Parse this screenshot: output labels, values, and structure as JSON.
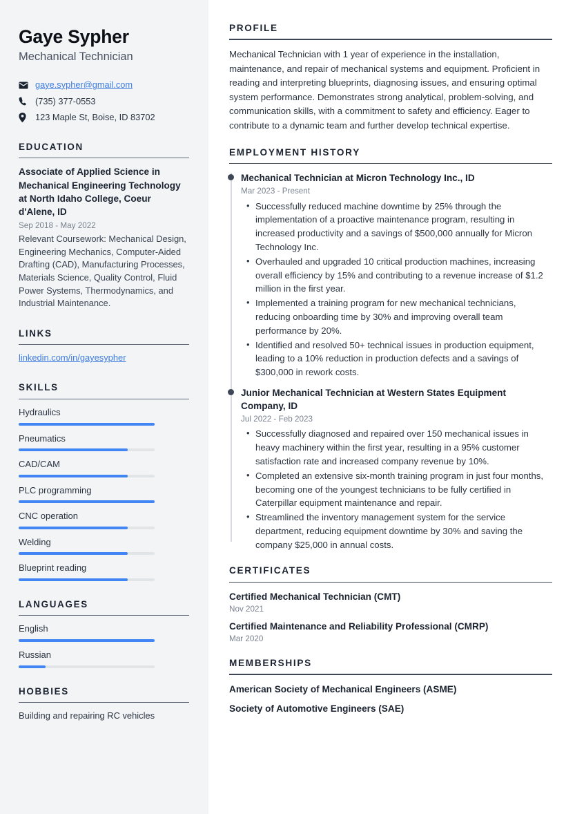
{
  "theme": {
    "accent_blue": "#4285f4",
    "link_blue": "#3f7de0",
    "sidebar_bg": "#f2f4f6",
    "heading_color": "#1b2330",
    "muted_text": "#7a828f",
    "timeline_dot": "#3f4756"
  },
  "sidebar": {
    "name": "Gaye Sypher",
    "job_title": "Mechanical Technician",
    "contacts": [
      {
        "icon": "envelope-icon",
        "text": "gaye.sypher@gmail.com",
        "is_link": true
      },
      {
        "icon": "phone-icon",
        "text": "(735) 377-0553",
        "is_link": false
      },
      {
        "icon": "map-pin-icon",
        "text": "123 Maple St, Boise, ID 83702",
        "is_link": false
      }
    ],
    "education": {
      "heading": "EDUCATION",
      "degree": "Associate of Applied Science in Mechanical Engineering Technology at North Idaho College, Coeur d'Alene, ID",
      "date": "Sep 2018 - May 2022",
      "description": "Relevant Coursework: Mechanical Design, Engineering Mechanics, Computer-Aided Drafting (CAD), Manufacturing Processes, Materials Science, Quality Control, Fluid Power Systems, Thermodynamics, and Industrial Maintenance."
    },
    "links": {
      "heading": "LINKS",
      "items": [
        {
          "label": "linkedin.com/in/gayesypher"
        }
      ]
    },
    "skills": {
      "heading": "SKILLS",
      "items": [
        {
          "label": "Hydraulics",
          "level": 100
        },
        {
          "label": "Pneumatics",
          "level": 80
        },
        {
          "label": "CAD/CAM",
          "level": 80
        },
        {
          "label": "PLC programming",
          "level": 100
        },
        {
          "label": "CNC operation",
          "level": 80
        },
        {
          "label": "Welding",
          "level": 80
        },
        {
          "label": "Blueprint reading",
          "level": 80
        }
      ]
    },
    "languages": {
      "heading": "LANGUAGES",
      "items": [
        {
          "label": "English",
          "level": 100
        },
        {
          "label": "Russian",
          "level": 20
        }
      ]
    },
    "hobbies": {
      "heading": "HOBBIES",
      "items": [
        {
          "label": "Building and repairing RC vehicles"
        }
      ]
    }
  },
  "main": {
    "profile": {
      "heading": "PROFILE",
      "text": "Mechanical Technician with 1 year of experience in the installation, maintenance, and repair of mechanical systems and equipment. Proficient in reading and interpreting blueprints, diagnosing issues, and ensuring optimal system performance. Demonstrates strong analytical, problem-solving, and communication skills, with a commitment to safety and efficiency. Eager to contribute to a dynamic team and further develop technical expertise."
    },
    "employment": {
      "heading": "EMPLOYMENT HISTORY",
      "jobs": [
        {
          "title": "Mechanical Technician at Micron Technology Inc., ID",
          "date": "Mar 2023 - Present",
          "bullets": [
            "Successfully reduced machine downtime by 25% through the implementation of a proactive maintenance program, resulting in increased productivity and a savings of $500,000 annually for Micron Technology Inc.",
            "Overhauled and upgraded 10 critical production machines, increasing overall efficiency by 15% and contributing to a revenue increase of $1.2 million in the first year.",
            "Implemented a training program for new mechanical technicians, reducing onboarding time by 30% and improving overall team performance by 20%.",
            "Identified and resolved 50+ technical issues in production equipment, leading to a 10% reduction in production defects and a savings of $300,000 in rework costs."
          ]
        },
        {
          "title": "Junior Mechanical Technician at Western States Equipment Company, ID",
          "date": "Jul 2022 - Feb 2023",
          "bullets": [
            "Successfully diagnosed and repaired over 150 mechanical issues in heavy machinery within the first year, resulting in a 95% customer satisfaction rate and increased company revenue by 10%.",
            "Completed an extensive six-month training program in just four months, becoming one of the youngest technicians to be fully certified in Caterpillar equipment maintenance and repair.",
            "Streamlined the inventory management system for the service department, reducing equipment downtime by 30% and saving the company $25,000 in annual costs."
          ]
        }
      ]
    },
    "certificates": {
      "heading": "CERTIFICATES",
      "items": [
        {
          "name": "Certified Mechanical Technician (CMT)",
          "date": "Nov 2021"
        },
        {
          "name": "Certified Maintenance and Reliability Professional (CMRP)",
          "date": "Mar 2020"
        }
      ]
    },
    "memberships": {
      "heading": "MEMBERSHIPS",
      "items": [
        {
          "name": "American Society of Mechanical Engineers (ASME)"
        },
        {
          "name": "Society of Automotive Engineers (SAE)"
        }
      ]
    }
  }
}
